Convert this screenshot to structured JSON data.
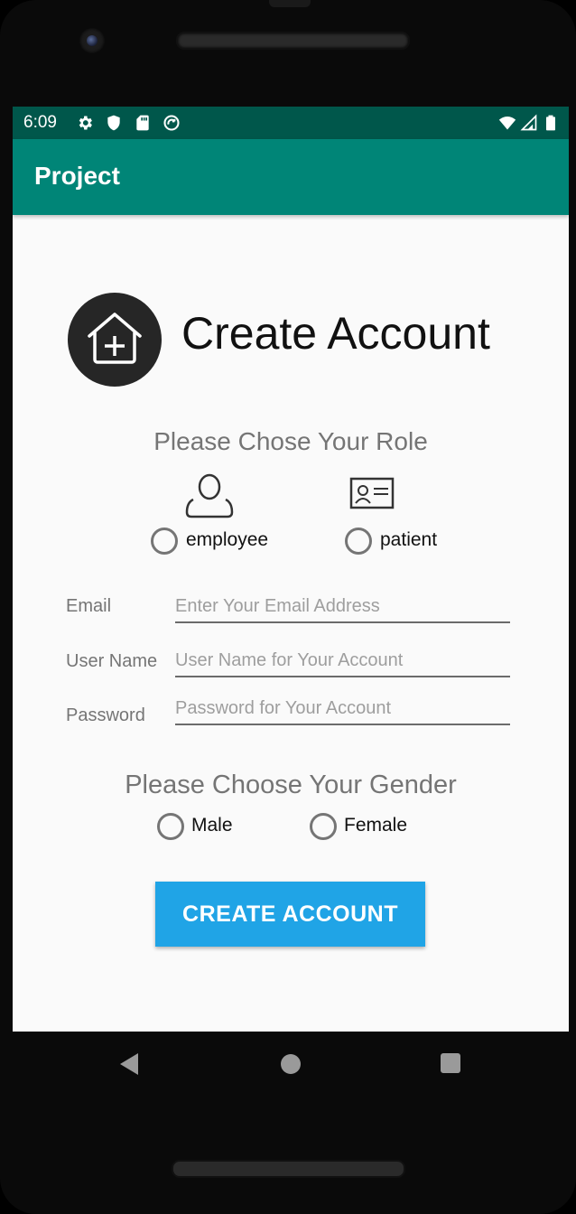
{
  "status_bar": {
    "time": "6:09",
    "left_icons": [
      "gear-icon",
      "shield-icon",
      "sd-card-icon",
      "sync-icon"
    ],
    "right_icons": [
      "wifi-icon",
      "signal-icon",
      "battery-icon"
    ]
  },
  "app_bar": {
    "title": "Project"
  },
  "header": {
    "title": "Create Account",
    "logo_icon": "home-add-icon"
  },
  "role": {
    "title": "Please Chose Your Role",
    "options": [
      {
        "label": "employee",
        "icon": "person-icon"
      },
      {
        "label": "patient",
        "icon": "id-card-icon"
      }
    ]
  },
  "form": {
    "email": {
      "label": "Email",
      "placeholder": "Enter Your Email Address",
      "value": ""
    },
    "username": {
      "label": "User Name",
      "placeholder": "User Name for Your Account",
      "value": ""
    },
    "password": {
      "label": "Password",
      "placeholder": "Password for Your Account",
      "value": ""
    }
  },
  "gender": {
    "title": "Please Choose Your Gender",
    "options": [
      {
        "label": "Male"
      },
      {
        "label": "Female"
      }
    ]
  },
  "actions": {
    "create_label": "CREATE ACCOUNT"
  },
  "colors": {
    "status_bar": "#00574b",
    "app_bar": "#008577",
    "button": "#20a4e6",
    "logo_bg": "#262626"
  },
  "nav_bar": {
    "buttons": [
      "back-icon",
      "home-icon",
      "recents-icon"
    ]
  }
}
